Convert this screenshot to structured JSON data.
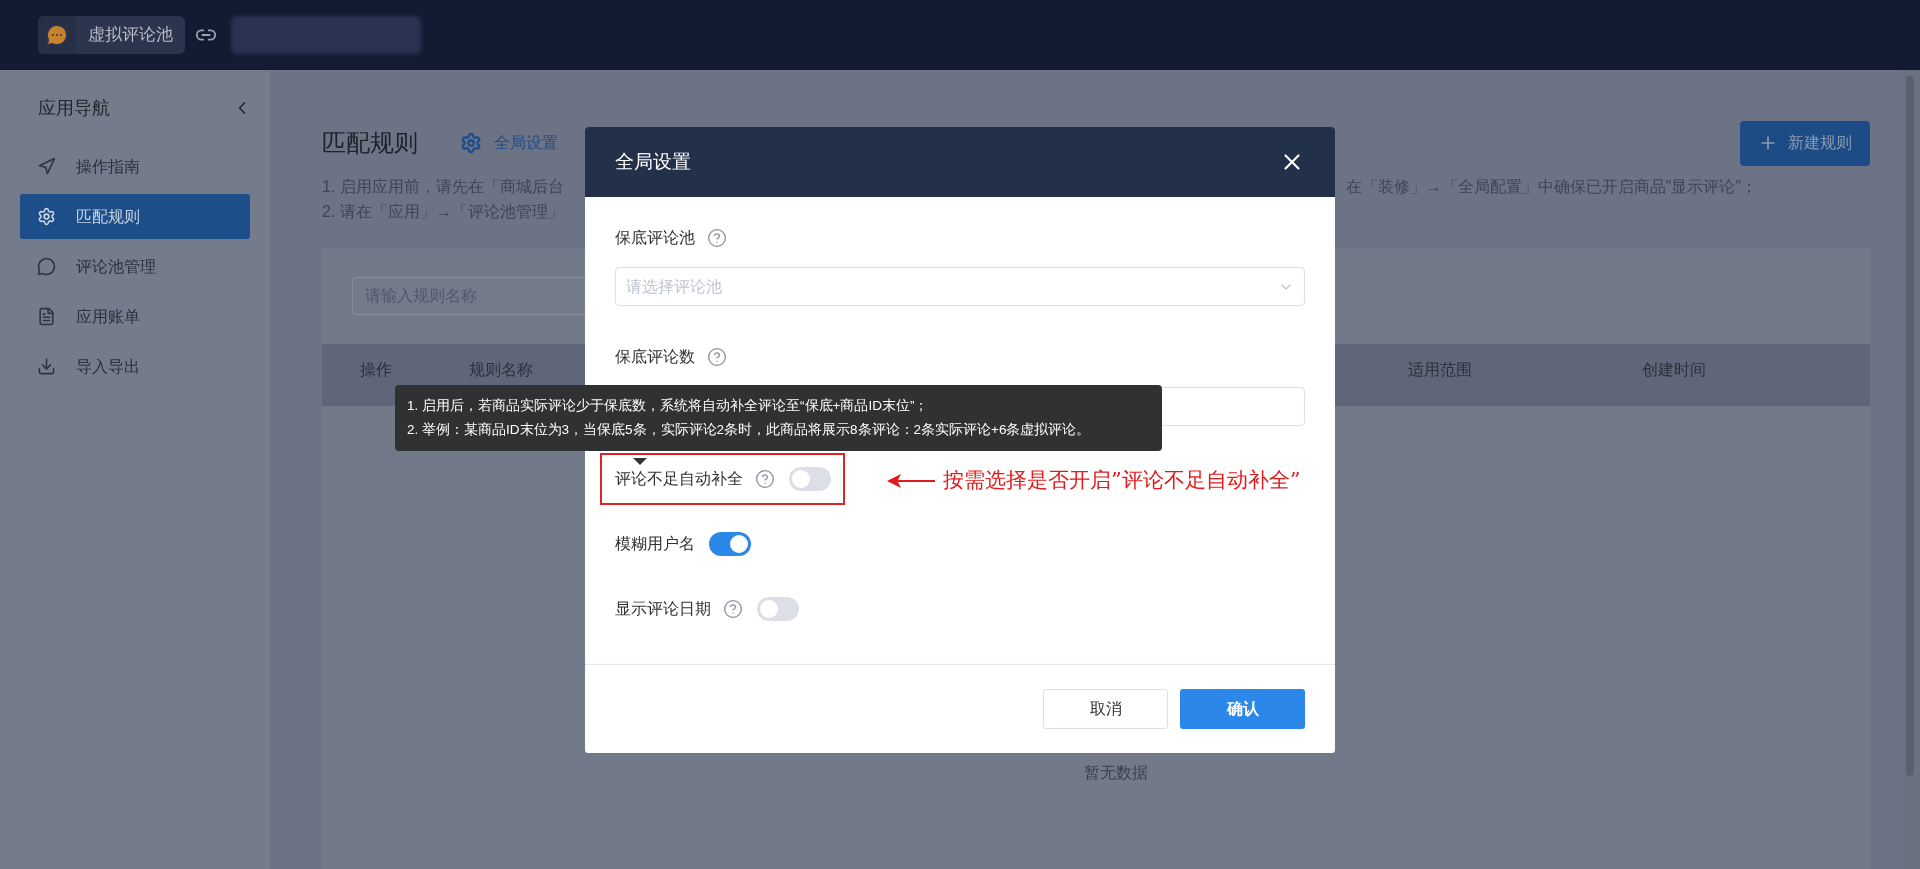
{
  "top_bar": {
    "app_name": "虚拟评论池"
  },
  "sidebar": {
    "title": "应用导航",
    "items": [
      {
        "label": "操作指南",
        "selected": false
      },
      {
        "label": "匹配规则",
        "selected": true
      },
      {
        "label": "评论池管理",
        "selected": false
      },
      {
        "label": "应用账单",
        "selected": false
      },
      {
        "label": "导入导出",
        "selected": false
      }
    ]
  },
  "page": {
    "title": "匹配规则",
    "settings_link": "全局设置",
    "new_button": "新建规则",
    "notes": [
      {
        "left": "1. 启用应用前，请先在「商城后台",
        "right": "在「装修」→「全局配置」中确保已开启商品\"显示评论\"；"
      },
      {
        "left": "2. 请在「应用」→「评论池管理」"
      }
    ],
    "search": {
      "placeholder": "请输入规则名称"
    },
    "table": {
      "columns": [
        {
          "label": "操作"
        },
        {
          "label": "规则名称"
        },
        {
          "label": "适用范围"
        },
        {
          "label": "创建时间"
        }
      ],
      "empty_text": "暂无数据"
    }
  },
  "dialog": {
    "title": "全局设置",
    "fields": [
      {
        "kind": "select",
        "label": "保底评论池",
        "help": true,
        "placeholder": "请选择评论池"
      },
      {
        "kind": "input",
        "label": "保底评论数",
        "help": true
      },
      {
        "kind": "switch",
        "label": "评论不足自动补全",
        "help": true,
        "on": false,
        "highlighted": true
      },
      {
        "kind": "switch",
        "label": "模糊用户名",
        "help": false,
        "on": true,
        "highlighted": false
      },
      {
        "kind": "switch",
        "label": "显示评论日期",
        "help": true,
        "on": false,
        "highlighted": false
      }
    ],
    "tooltip": {
      "lines": [
        "1. 启用后，若商品实际评论少于保底数，系统将自动补全评论至“保底+商品ID末位”；",
        "2. 举例：某商品ID末位为3，当保底5条，实际评论2条时，此商品将展示8条评论：2条实际评论+6条虚拟评论。"
      ]
    },
    "buttons": [
      {
        "label": "取消",
        "kind": "secondary"
      },
      {
        "label": "确认",
        "kind": "primary"
      }
    ]
  },
  "annotation": {
    "text": "按需选择是否开启”评论不足自动补全”"
  }
}
